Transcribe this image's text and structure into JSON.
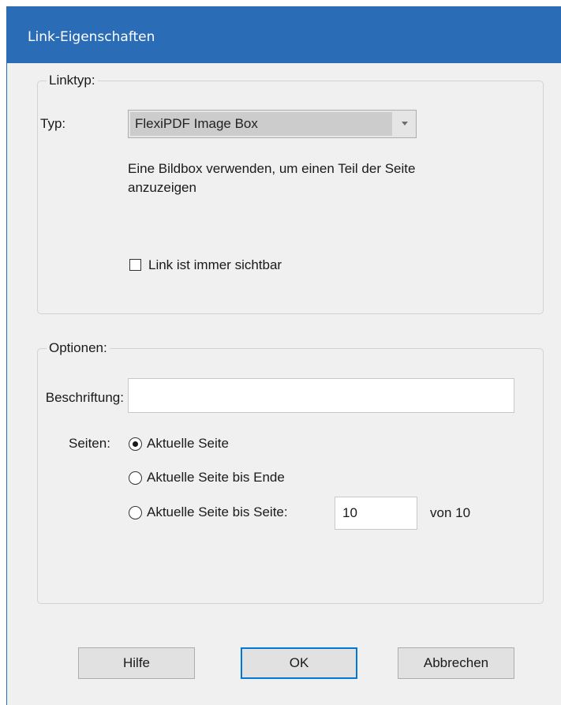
{
  "window": {
    "title": "Link-Eigenschaften"
  },
  "linktype_group": {
    "label": "Linktyp:",
    "type_label": "Typ:",
    "type_selected": "FlexiPDF Image Box",
    "description_line1": "Eine Bildbox verwenden, um einen Teil der Seite",
    "description_line2": "anzuzeigen",
    "always_visible_label": "Link ist immer sichtbar",
    "always_visible_checked": false
  },
  "options_group": {
    "label": "Optionen:",
    "caption_label": "Beschriftung:",
    "caption_value": "",
    "pages_label": "Seiten:",
    "radio_current_page": "Aktuelle Seite",
    "radio_current_to_end": "Aktuelle Seite bis Ende",
    "radio_current_to_page": "Aktuelle Seite bis Seite:",
    "selected_option": "Aktuelle Seite",
    "to_page_value": "10",
    "of_pages_text": "von 10"
  },
  "buttons": {
    "help": "Hilfe",
    "ok": "OK",
    "cancel": "Abbrechen"
  },
  "colors": {
    "titlebar": "#2b6cb7",
    "dialog_bg": "#f0f0f0",
    "default_button_border": "#0078d7"
  }
}
